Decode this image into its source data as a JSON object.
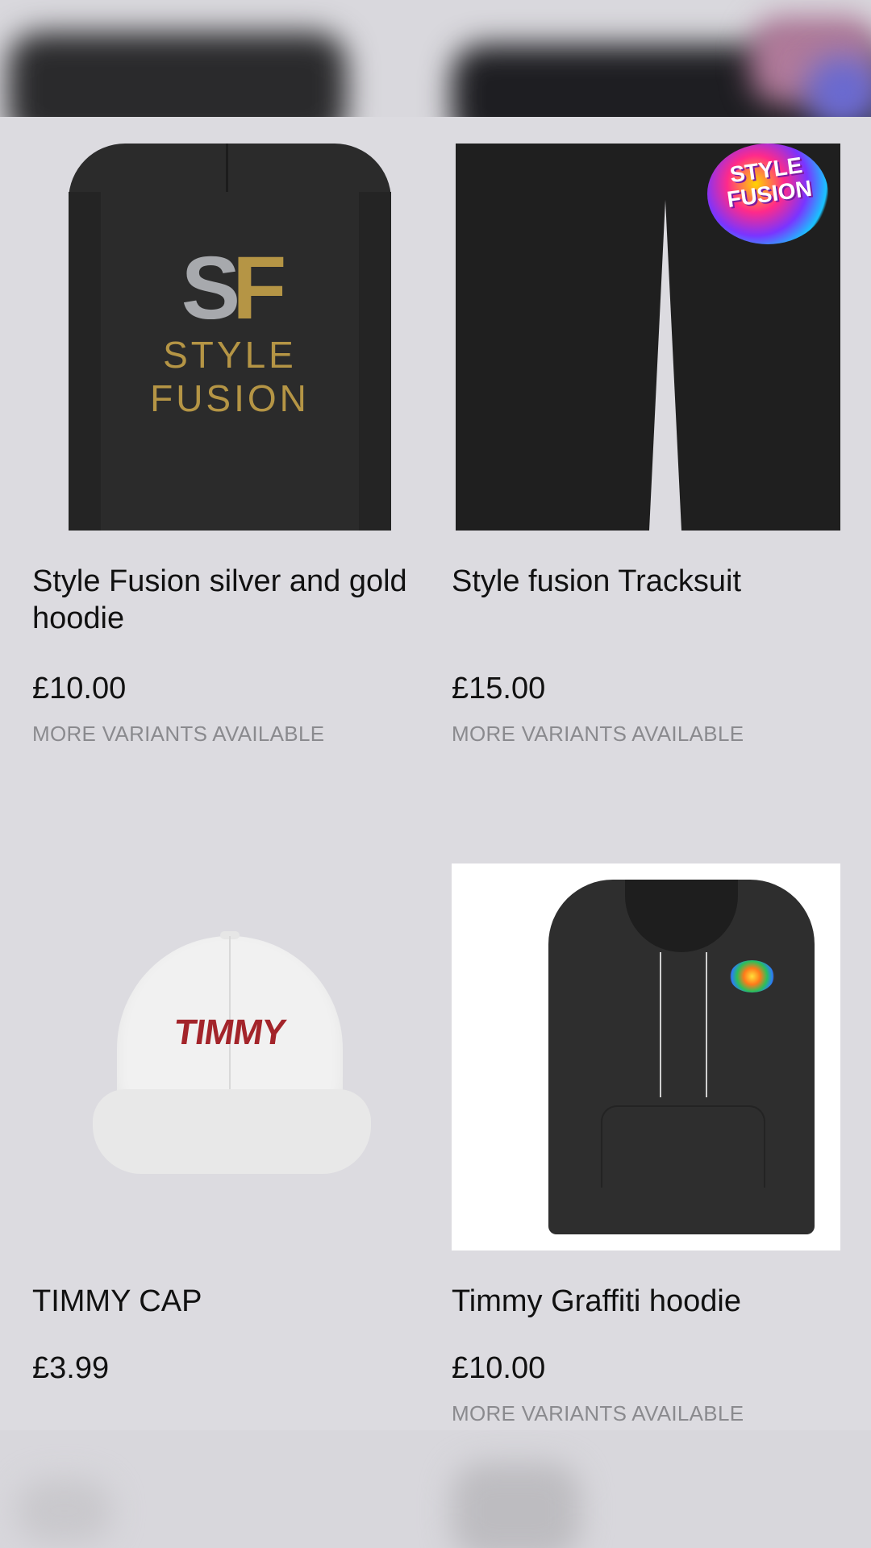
{
  "products": [
    {
      "title": "Style Fusion silver and gold hoodie",
      "price": "£10.00",
      "variants": "MORE VARIANTS AVAILABLE",
      "logo_mark": "SF",
      "logo_word_1": "STYLE",
      "logo_word_2": "FUSION"
    },
    {
      "title": "Style fusion Tracksuit",
      "price": "£15.00",
      "variants": "MORE VARIANTS AVAILABLE",
      "logo_text": "STYLE FUSION"
    },
    {
      "title": "TIMMY CAP",
      "price": "£3.99",
      "cap_text": "TIMMY"
    },
    {
      "title": "Timmy Graffiti hoodie",
      "price": "£10.00",
      "variants": "MORE VARIANTS AVAILABLE"
    }
  ],
  "colors": {
    "background": "#dcdbe0",
    "gold": "#b59545",
    "cap_red": "#a3242a",
    "muted_text": "#8a8a8e"
  }
}
